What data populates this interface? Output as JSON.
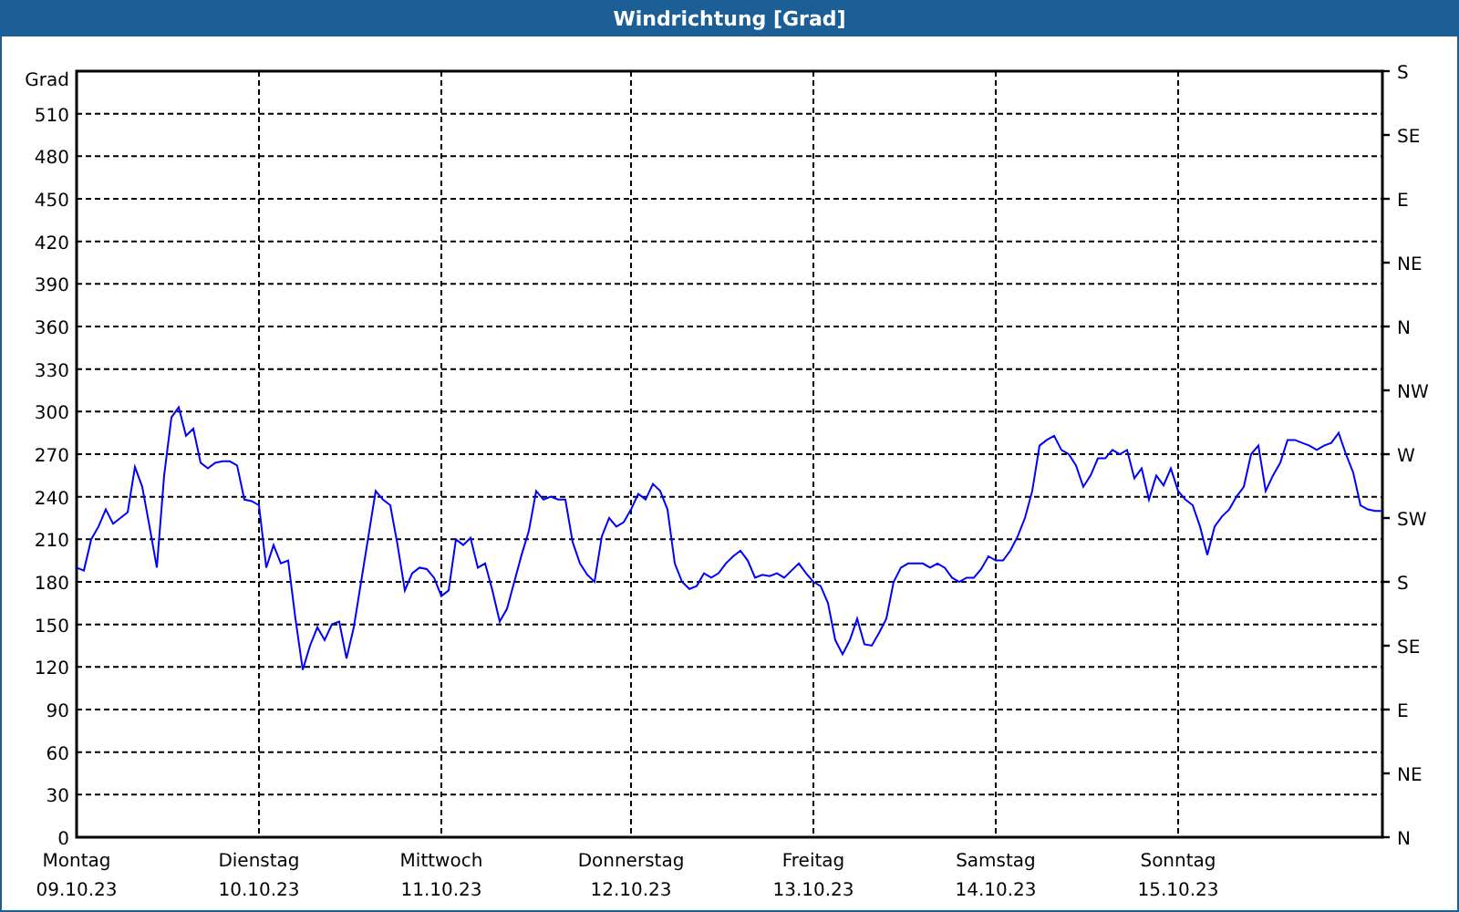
{
  "window": {
    "title": "Windrichtung [Grad]"
  },
  "chart": {
    "compass_axis": [
      "S",
      "SE",
      "E",
      "NE",
      "N",
      "NW",
      "W",
      "SW",
      "S",
      "SE",
      "E",
      "NE",
      "N"
    ],
    "chart_data": {
      "type": "line",
      "grid": true,
      "ylabel": "Grad",
      "ylim": [
        0,
        540
      ],
      "yticks": [
        0,
        30,
        60,
        90,
        120,
        150,
        180,
        210,
        240,
        270,
        300,
        330,
        360,
        390,
        420,
        450,
        480,
        510
      ],
      "categories": [
        "Montag\n09.10.23",
        null,
        null,
        null,
        null,
        null,
        null,
        null,
        null,
        null,
        null,
        null,
        null,
        null,
        null,
        null,
        null,
        null,
        null,
        null,
        null,
        null,
        null,
        null,
        null,
        "Dienstag\n10.10.23",
        null,
        null,
        null,
        null,
        null,
        null,
        null,
        null,
        null,
        null,
        null,
        null,
        null,
        null,
        null,
        null,
        null,
        null,
        null,
        null,
        null,
        null,
        null,
        null,
        "Mittwoch\n11.10.23",
        null,
        null,
        null,
        null,
        null,
        null,
        null,
        null,
        null,
        null,
        null,
        null,
        null,
        null,
        null,
        null,
        null,
        null,
        null,
        null,
        null,
        null,
        null,
        null,
        null,
        "Donnerstag\n12.10.23",
        null,
        null,
        null,
        null,
        null,
        null,
        null,
        null,
        null,
        null,
        null,
        null,
        null,
        null,
        null,
        null,
        null,
        null,
        null,
        null,
        null,
        null,
        null,
        null,
        "Freitag\n13.10.23",
        null,
        null,
        null,
        null,
        null,
        null,
        null,
        null,
        null,
        null,
        null,
        null,
        null,
        null,
        null,
        null,
        null,
        null,
        null,
        null,
        null,
        null,
        null,
        null,
        "Samstag\n14.10.23",
        null,
        null,
        null,
        null,
        null,
        null,
        null,
        null,
        null,
        null,
        null,
        null,
        null,
        null,
        null,
        null,
        null,
        null,
        null,
        null,
        null,
        null,
        null,
        null,
        "Sonntag\n15.10.23",
        null,
        null,
        null,
        null,
        null,
        null,
        null,
        null,
        null,
        null,
        null,
        null,
        null,
        null,
        null,
        null,
        null,
        null,
        null,
        null,
        null,
        null,
        null,
        null,
        null,
        null,
        null,
        null
      ],
      "series": [
        {
          "color": "#0000ff",
          "values": [
            190,
            188,
            210,
            219,
            231,
            221,
            225,
            229,
            261,
            247,
            219,
            190,
            255,
            296,
            303,
            283,
            288,
            264,
            260,
            264,
            265,
            265,
            262,
            238,
            237,
            234,
            190,
            206,
            193,
            195,
            154,
            118,
            135,
            148,
            139,
            150,
            152,
            126,
            148,
            180,
            212,
            244,
            238,
            234,
            206,
            174,
            186,
            190,
            189,
            183,
            170,
            174,
            210,
            206,
            211,
            190,
            193,
            174,
            152,
            161,
            180,
            199,
            216,
            244,
            238,
            240,
            238,
            238,
            208,
            193,
            185,
            180,
            212,
            225,
            219,
            222,
            231,
            242,
            238,
            249,
            244,
            231,
            193,
            180,
            175,
            177,
            186,
            183,
            186,
            193,
            198,
            202,
            195,
            183,
            185,
            184,
            186,
            183,
            188,
            193,
            186,
            180,
            177,
            165,
            139,
            129,
            139,
            154,
            136,
            135,
            144,
            154,
            180,
            190,
            193,
            193,
            193,
            190,
            193,
            190,
            183,
            180,
            183,
            183,
            189,
            198,
            195,
            195,
            202,
            212,
            225,
            244,
            276,
            280,
            283,
            273,
            270,
            262,
            247,
            255,
            267,
            267,
            273,
            270,
            273,
            253,
            260,
            238,
            255,
            248,
            260,
            244,
            238,
            234,
            219,
            199,
            219,
            226,
            231,
            240,
            247,
            270,
            276,
            244,
            255,
            264,
            280,
            280,
            278,
            276,
            273,
            276,
            278,
            285,
            270,
            257,
            234,
            231,
            230,
            230
          ]
        }
      ]
    }
  }
}
